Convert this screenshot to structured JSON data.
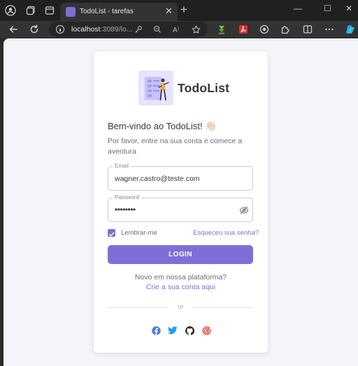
{
  "browser": {
    "tab_title": "TodoList - tarefas",
    "tab_close": "✕",
    "new_tab": "+",
    "controls": {
      "minimize": "—",
      "maximize": "☐",
      "close": "✕"
    },
    "url_host": "localhost",
    "url_rest": ":3089/lo...",
    "accent": "#7e6fd8"
  },
  "app": {
    "brand": "TodoList",
    "welcome": "Bem-vindo ao TodoList! 👋🏻",
    "subtitle": "Por favor, entre na sua conta e comece a aventura",
    "email_label": "Email",
    "email_value": "wagner.castro@teste.com",
    "password_label": "Password",
    "password_value": "••••••••",
    "remember": "Lembrar-me",
    "forgot": "Esqueceu sua senha?",
    "login": "LOGIN",
    "signup_question": "Novo em nossa plataforma?",
    "signup_link": "Crie a sua conta aqui",
    "or": "or",
    "social": [
      "facebook-icon",
      "twitter-icon",
      "github-icon",
      "google-icon"
    ]
  }
}
